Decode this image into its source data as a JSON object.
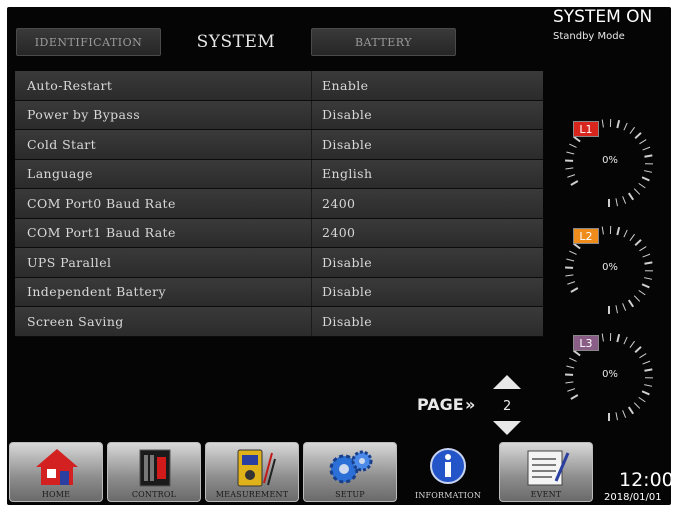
{
  "tabs": [
    {
      "label": "IDENTIFICATION",
      "active": false
    },
    {
      "label": "SYSTEM",
      "active": true
    },
    {
      "label": "BATTERY",
      "active": false
    }
  ],
  "settings": [
    {
      "label": "Auto-Restart",
      "value": "Enable"
    },
    {
      "label": "Power by Bypass",
      "value": "Disable"
    },
    {
      "label": "Cold Start",
      "value": "Disable"
    },
    {
      "label": "Language",
      "value": "English"
    },
    {
      "label": "COM Port0 Baud Rate",
      "value": "2400"
    },
    {
      "label": "COM Port1 Baud Rate",
      "value": "2400"
    },
    {
      "label": "UPS Parallel",
      "value": "Disable"
    },
    {
      "label": "Independent Battery",
      "value": "Disable"
    },
    {
      "label": "Screen Saving",
      "value": "Disable"
    }
  ],
  "page": {
    "label": "PAGE",
    "chevron": "»",
    "number": "2"
  },
  "status": {
    "title": "SYSTEM ON",
    "mode": "Standby Mode"
  },
  "gauges": [
    {
      "label": "L1",
      "value": "0%",
      "level": 0,
      "color": "#d8261f"
    },
    {
      "label": "L2",
      "value": "0%",
      "level": 0,
      "color": "#f08c1c"
    },
    {
      "label": "L3",
      "value": "0%",
      "level": 0,
      "color": "#8a5d86"
    }
  ],
  "nav": [
    {
      "label": "HOME",
      "icon": "home-icon"
    },
    {
      "label": "CONTROL",
      "icon": "control-icon"
    },
    {
      "label": "MEASUREMENT",
      "icon": "multimeter-icon"
    },
    {
      "label": "SETUP",
      "icon": "gears-icon"
    },
    {
      "label": "INFORMATION",
      "icon": "info-icon"
    },
    {
      "label": "EVENT",
      "icon": "event-log-icon"
    }
  ],
  "clock": {
    "time": "12:00",
    "date": "2018/01/01"
  }
}
